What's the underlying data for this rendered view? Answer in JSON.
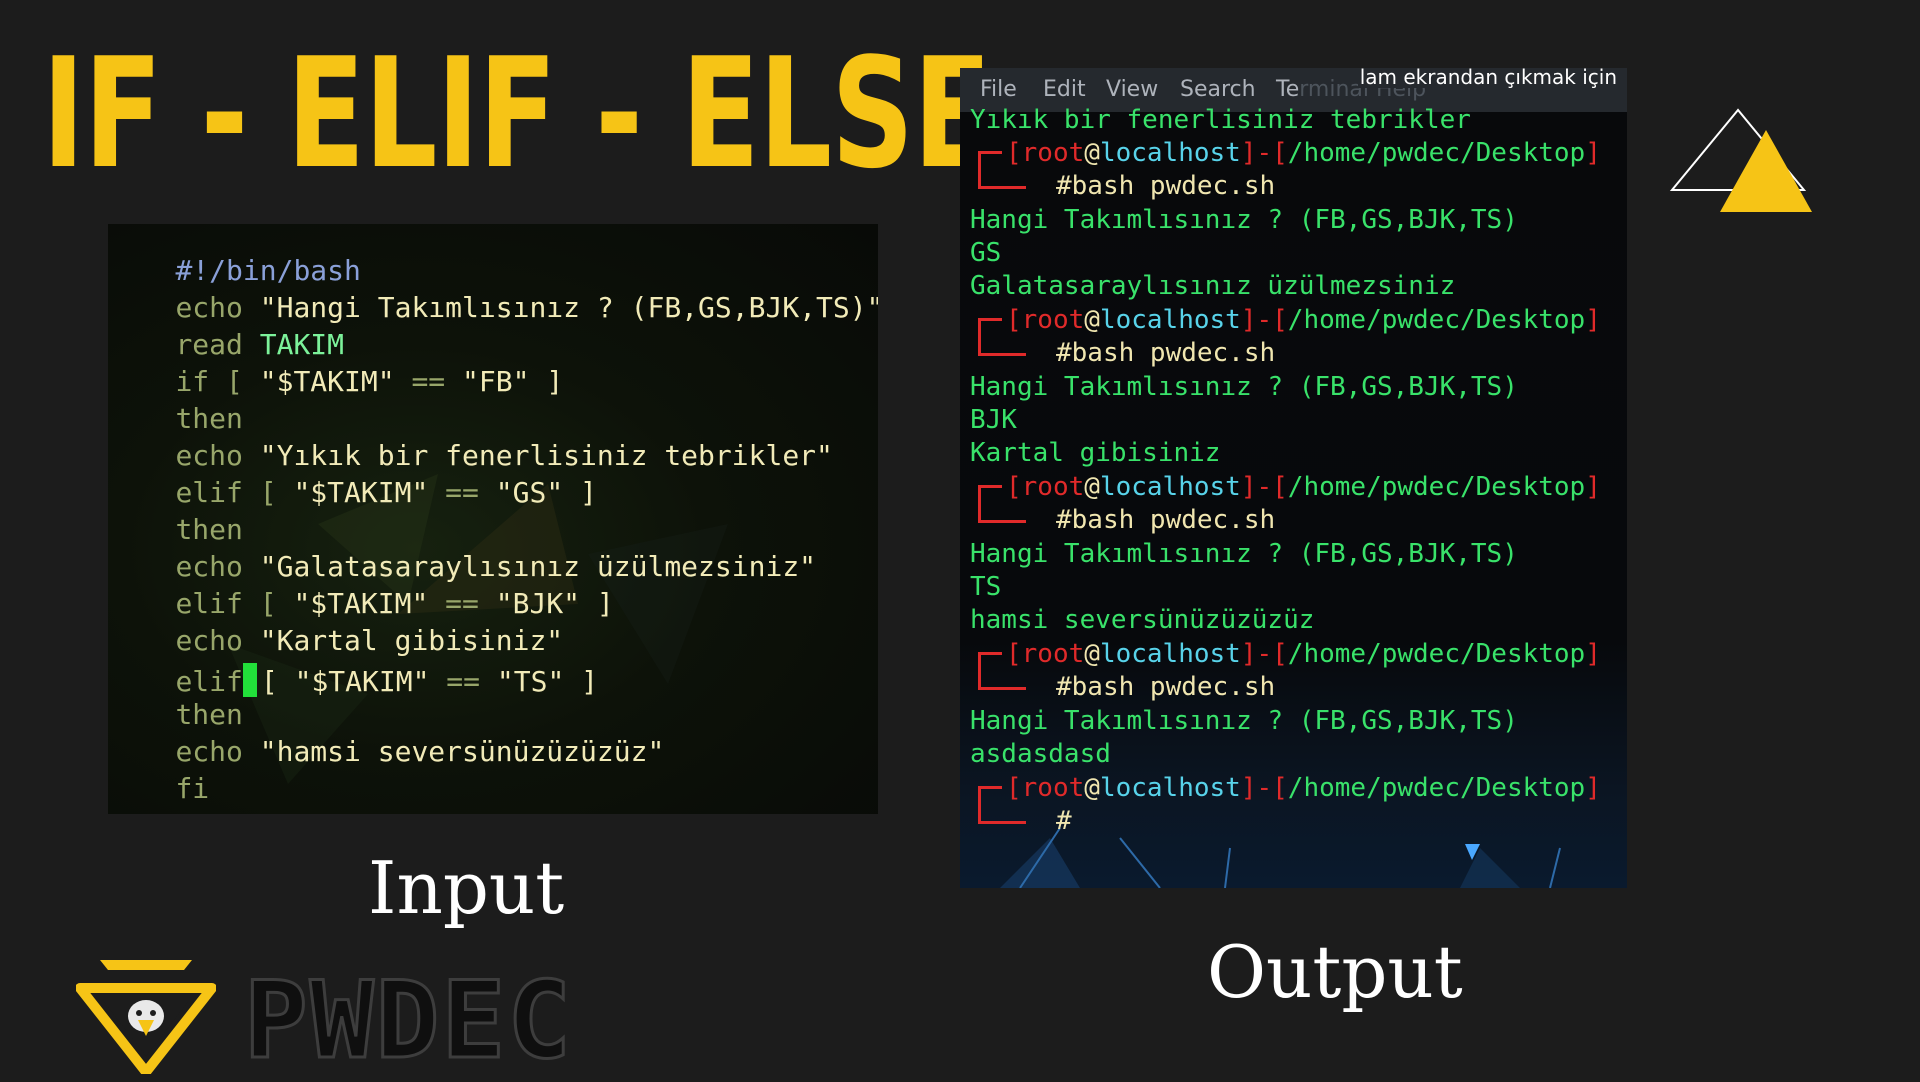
{
  "title": "IF - ELIF - ELSE",
  "code": {
    "lines": [
      {
        "a": "#!/bin/bash",
        "b": "",
        "c": "",
        "d": ""
      },
      {
        "a": "echo ",
        "b": "\"Hangi Takımlısınız ? (FB,GS,BJK,TS)\"",
        "c": "",
        "d": ""
      },
      {
        "a": "read ",
        "b": "TAKIM",
        "c": "",
        "d": ""
      },
      {
        "a": "if [ ",
        "b": "\"$TAKIM\"",
        "c": " == ",
        "d": "\"FB\" ]"
      },
      {
        "a": "then",
        "b": "",
        "c": "",
        "d": ""
      },
      {
        "a": "echo ",
        "b": "\"Yıkık bir fenerlisiniz tebrikler\"",
        "c": "",
        "d": ""
      },
      {
        "a": "elif [ ",
        "b": "\"$TAKIM\"",
        "c": " == ",
        "d": "\"GS\" ]"
      },
      {
        "a": "then",
        "b": "",
        "c": "",
        "d": ""
      },
      {
        "a": "echo ",
        "b": "\"Galatasaraylısınız üzülmezsiniz\"",
        "c": "",
        "d": ""
      },
      {
        "a": "elif [ ",
        "b": "\"$TAKIM\"",
        "c": " == ",
        "d": "\"BJK\" ]"
      },
      {
        "a": "echo ",
        "b": "\"Kartal gibisiniz\"",
        "c": "",
        "d": ""
      },
      {
        "a": "elif",
        "b": "[ \"$TAKIM\"",
        "c": " == ",
        "d": "\"TS\" ]"
      },
      {
        "a": "then",
        "b": "",
        "c": "",
        "d": ""
      },
      {
        "a": "echo ",
        "b": "\"hamsi seversünüzüzüzüz\"",
        "c": "",
        "d": ""
      },
      {
        "a": "fi",
        "b": "",
        "c": "",
        "d": ""
      }
    ]
  },
  "captions": {
    "input": "Input",
    "output": "Output"
  },
  "terminal": {
    "menu": [
      "File",
      "Edit",
      "View",
      "Search",
      "Te"
    ],
    "menu_ghost": "rminal  Help",
    "tooltip": "lam ekrandan çıkmak için",
    "prompt": {
      "user": "root",
      "at": "@",
      "host": "localhost",
      "path": "/home/pwdec/Desktop"
    },
    "command": "#bash pwdec.sh",
    "final_command": "#",
    "question": "Hangi Takımlısınız ? (FB,GS,BJK,TS)",
    "first_line": "Yıkık bir fenerlisiniz tebrikler",
    "blocks": [
      {
        "input": "GS",
        "output": "Galatasaraylısınız üzülmezsiniz"
      },
      {
        "input": "BJK",
        "output": "Kartal gibisiniz"
      },
      {
        "input": "TS",
        "output": "hamsi seversünüzüzüzüz"
      },
      {
        "input": "asdasdasd",
        "output": ""
      }
    ]
  },
  "logo": {
    "text": "PWDEC"
  },
  "colors": {
    "accent": "#f6c416",
    "background": "#1c1c1c",
    "terminal_green": "#39e26a",
    "prompt_red": "#e02a2a"
  }
}
